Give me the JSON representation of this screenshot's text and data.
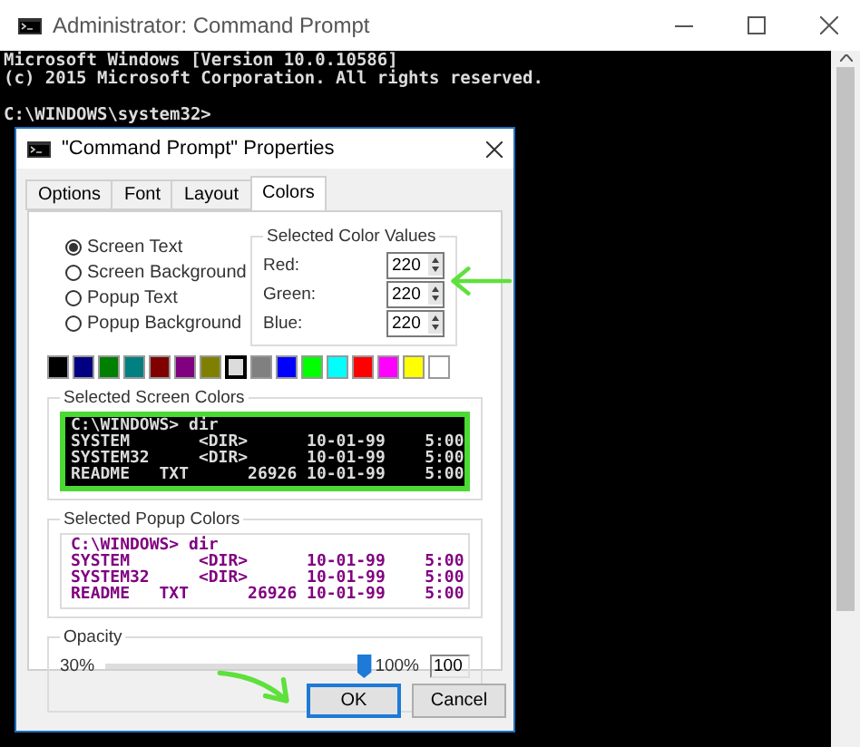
{
  "window": {
    "title": "Administrator: Command Prompt"
  },
  "console": {
    "banner": [
      "Microsoft Windows [Version 10.0.10586]",
      "(c) 2015 Microsoft Corporation. All rights reserved."
    ],
    "prompt": "C:\\WINDOWS\\system32>"
  },
  "dialog": {
    "title": "\"Command Prompt\" Properties",
    "tabs": [
      {
        "label": "Options",
        "selected": false
      },
      {
        "label": "Font",
        "selected": false
      },
      {
        "label": "Layout",
        "selected": false
      },
      {
        "label": "Colors",
        "selected": true
      }
    ],
    "targets": [
      {
        "label": "Screen Text",
        "selected": true
      },
      {
        "label": "Screen Background",
        "selected": false
      },
      {
        "label": "Popup Text",
        "selected": false
      },
      {
        "label": "Popup Background",
        "selected": false
      }
    ],
    "color_values": {
      "title": "Selected Color Values",
      "fields": [
        {
          "label": "Red:",
          "value": "220"
        },
        {
          "label": "Green:",
          "value": "220"
        },
        {
          "label": "Blue:",
          "value": "220"
        }
      ]
    },
    "swatches": [
      {
        "color": "#000000",
        "selected": false
      },
      {
        "color": "#000080",
        "selected": false
      },
      {
        "color": "#008000",
        "selected": false
      },
      {
        "color": "#008080",
        "selected": false
      },
      {
        "color": "#800000",
        "selected": false
      },
      {
        "color": "#800080",
        "selected": false
      },
      {
        "color": "#808000",
        "selected": false
      },
      {
        "color": "#dcdcdc",
        "selected": true
      },
      {
        "color": "#808080",
        "selected": false
      },
      {
        "color": "#0000ff",
        "selected": false
      },
      {
        "color": "#00ff00",
        "selected": false
      },
      {
        "color": "#00ffff",
        "selected": false
      },
      {
        "color": "#ff0000",
        "selected": false
      },
      {
        "color": "#ff00ff",
        "selected": false
      },
      {
        "color": "#ffff00",
        "selected": false
      },
      {
        "color": "#ffffff",
        "selected": false
      }
    ],
    "screen_preview": {
      "title": "Selected Screen Colors",
      "lines": [
        "C:\\WINDOWS> dir",
        "SYSTEM       <DIR>      10-01-99    5:00",
        "SYSTEM32     <DIR>      10-01-99    5:00",
        "README   TXT      26926 10-01-99    5:00"
      ]
    },
    "popup_preview": {
      "title": "Selected Popup Colors",
      "lines": [
        "C:\\WINDOWS> dir",
        "SYSTEM       <DIR>      10-01-99    5:00",
        "SYSTEM32     <DIR>      10-01-99    5:00",
        "README   TXT      26926 10-01-99    5:00"
      ]
    },
    "opacity": {
      "title": "Opacity",
      "min_label": "30%",
      "max_label": "100%",
      "level": 1,
      "value": "100"
    },
    "buttons": [
      {
        "label": "OK",
        "selected": true
      },
      {
        "label": "Cancel",
        "selected": false
      }
    ]
  }
}
